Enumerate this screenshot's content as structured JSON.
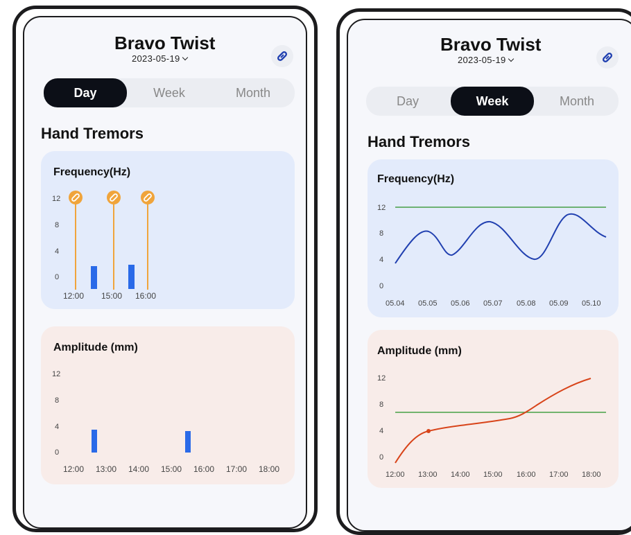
{
  "screens": [
    {
      "title": "Bravo Twist",
      "date": "2023-05-19",
      "tabs": [
        "Day",
        "Week",
        "Month"
      ],
      "active_tab": "Day",
      "section": "Hand Tremors",
      "frequency": {
        "title": "Frequency(Hz)",
        "y_ticks": [
          "12",
          "8",
          "4",
          "0"
        ],
        "x_ticks": [
          "12:00",
          "15:00",
          "16:00"
        ],
        "event_icon": "link-icon",
        "chart_data": {
          "type": "bar",
          "ylabel": "Frequency(Hz)",
          "ylim": [
            0,
            12
          ],
          "events": [
            "12:00",
            "15:00",
            "16:00"
          ],
          "bars": [
            {
              "between": [
                "12:00",
                "15:00"
              ],
              "value": 3
            },
            {
              "between": [
                "15:00",
                "16:00"
              ],
              "value": 3.2
            }
          ]
        }
      },
      "amplitude": {
        "title": "Amplitude (mm)",
        "y_ticks": [
          "12",
          "8",
          "4",
          "0"
        ],
        "x_ticks": [
          "12:00",
          "13:00",
          "14:00",
          "15:00",
          "16:00",
          "17:00",
          "18:00"
        ],
        "chart_data": {
          "type": "bar",
          "ylabel": "Amplitude (mm)",
          "ylim": [
            0,
            12
          ],
          "bars": [
            {
              "x": "13:00",
              "value": 3.5
            },
            {
              "x": "15:30",
              "value": 3.3
            }
          ]
        }
      }
    },
    {
      "title": "Bravo Twist",
      "date": "2023-05-19",
      "tabs": [
        "Day",
        "Week",
        "Month"
      ],
      "active_tab": "Week",
      "section": "Hand Tremors",
      "frequency": {
        "title": "Frequency(Hz)",
        "y_ticks": [
          "12",
          "8",
          "4",
          "0"
        ],
        "x_ticks": [
          "05.04",
          "05.05",
          "05.06",
          "05.07",
          "05.08",
          "05.09",
          "05.10"
        ],
        "chart_data": {
          "type": "line",
          "ylabel": "Frequency(Hz)",
          "ylim": [
            0,
            12
          ],
          "categories": [
            "05.04",
            "05.05",
            "05.06",
            "05.07",
            "05.08",
            "05.09",
            "05.10"
          ],
          "series": [
            {
              "values": [
                3.5,
                8.5,
                4.5,
                9.5,
                4,
                11,
                7.5
              ],
              "color": "#2140b0"
            }
          ],
          "reference_line": {
            "value": 12,
            "color": "#46a046"
          }
        }
      },
      "amplitude": {
        "title": "Amplitude (mm)",
        "y_ticks": [
          "12",
          "8",
          "4",
          "0"
        ],
        "x_ticks": [
          "12:00",
          "13:00",
          "14:00",
          "15:00",
          "16:00",
          "17:00",
          "18:00"
        ],
        "chart_data": {
          "type": "line",
          "ylabel": "Amplitude (mm)",
          "ylim": [
            0,
            12
          ],
          "categories": [
            "12:00",
            "13:00",
            "14:00",
            "15:00",
            "16:00",
            "17:00",
            "18:00"
          ],
          "series": [
            {
              "values": [
                0,
                4,
                4.8,
                5.5,
                6.5,
                9.5,
                12
              ],
              "color": "#d8441a",
              "marker_at": "13:00"
            }
          ],
          "reference_line": {
            "value": 7,
            "color": "#46a046"
          }
        }
      }
    }
  ],
  "colors": {
    "bar": "#2a6ae8",
    "event_line": "#f0a43b",
    "active_tab_bg": "#0c0f17",
    "card_blue": "#e3ebfb",
    "card_pink": "#f8ece9"
  }
}
